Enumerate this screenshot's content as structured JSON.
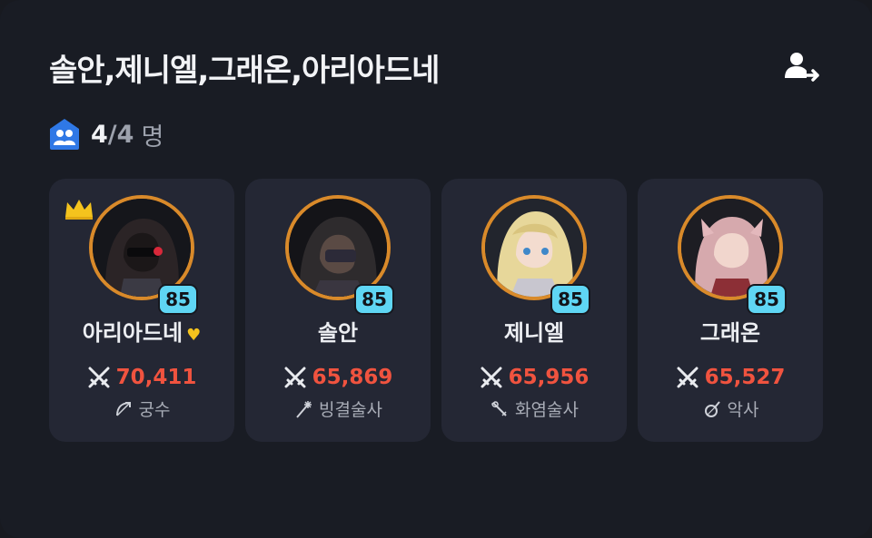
{
  "party": {
    "title": "솔안,제니엘,그래온,아리아드네",
    "count_current": "4",
    "count_separator": "/",
    "count_max": "4",
    "count_unit": "명"
  },
  "icons": {
    "swap": "member-swap-icon",
    "party": "party-members-icon",
    "crown": "crown-icon",
    "power": "crossed-swords-icon",
    "favorite": "heart-icon"
  },
  "colors": {
    "background": "#191c24",
    "card": "#242734",
    "power": "#f0533f",
    "level_badge": "#5fd6f4",
    "avatar_ring": "#d98a2a",
    "crown": "#f4c31d"
  },
  "members": [
    {
      "name": "아리아드네",
      "heart": "♥",
      "level": "85",
      "power": "70,411",
      "class": "궁수",
      "class_icon": "bow-icon",
      "leader": true
    },
    {
      "name": "솔안",
      "level": "85",
      "power": "65,869",
      "class": "빙결술사",
      "class_icon": "frost-staff-icon",
      "leader": false
    },
    {
      "name": "제니엘",
      "level": "85",
      "power": "65,956",
      "class": "화염술사",
      "class_icon": "fire-staff-icon",
      "leader": false
    },
    {
      "name": "그래온",
      "level": "85",
      "power": "65,527",
      "class": "악사",
      "class_icon": "lute-icon",
      "leader": false
    }
  ]
}
